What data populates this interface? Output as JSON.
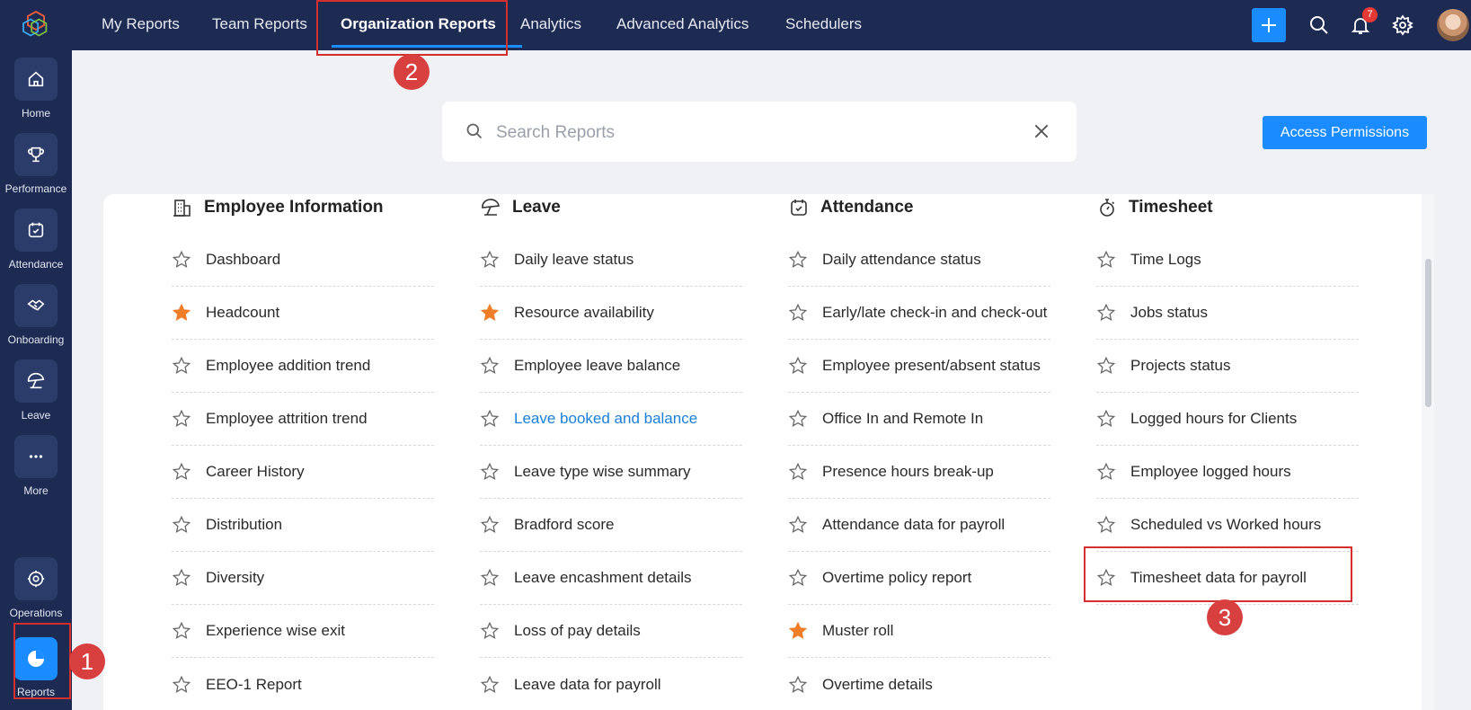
{
  "sidebar": {
    "items": [
      {
        "label": "Home",
        "icon": "home-icon"
      },
      {
        "label": "Performance",
        "icon": "trophy-icon"
      },
      {
        "label": "Attendance",
        "icon": "calendar-check-icon"
      },
      {
        "label": "Onboarding",
        "icon": "handshake-icon"
      },
      {
        "label": "Leave",
        "icon": "umbrella-icon"
      },
      {
        "label": "More",
        "icon": "more-icon"
      },
      {
        "label": "Operations",
        "icon": "operations-icon"
      },
      {
        "label": "Reports",
        "icon": "pie-chart-icon"
      }
    ]
  },
  "topnav": {
    "tabs": [
      {
        "label": "My Reports"
      },
      {
        "label": "Team Reports"
      },
      {
        "label": "Organization Reports"
      },
      {
        "label": "Analytics"
      },
      {
        "label": "Advanced Analytics"
      },
      {
        "label": "Schedulers"
      }
    ],
    "notification_count": "7"
  },
  "search": {
    "placeholder": "Search Reports"
  },
  "access_permissions_label": "Access Permissions",
  "columns": [
    {
      "title": "Employee Information",
      "icon": "building-icon",
      "items": [
        {
          "label": "Dashboard",
          "starred": false
        },
        {
          "label": "Headcount",
          "starred": true
        },
        {
          "label": "Employee addition trend",
          "starred": false
        },
        {
          "label": "Employee attrition trend",
          "starred": false
        },
        {
          "label": "Career History",
          "starred": false
        },
        {
          "label": "Distribution",
          "starred": false
        },
        {
          "label": "Diversity",
          "starred": false
        },
        {
          "label": "Experience wise exit",
          "starred": false
        },
        {
          "label": "EEO-1 Report",
          "starred": false
        }
      ]
    },
    {
      "title": "Leave",
      "icon": "umbrella-icon",
      "items": [
        {
          "label": "Daily leave status",
          "starred": false
        },
        {
          "label": "Resource availability",
          "starred": true
        },
        {
          "label": "Employee leave balance",
          "starred": false
        },
        {
          "label": "Leave booked and balance",
          "starred": false,
          "link": true
        },
        {
          "label": "Leave type wise summary",
          "starred": false
        },
        {
          "label": "Bradford score",
          "starred": false
        },
        {
          "label": "Leave encashment details",
          "starred": false
        },
        {
          "label": "Loss of pay details",
          "starred": false
        },
        {
          "label": "Leave data for payroll",
          "starred": false
        }
      ]
    },
    {
      "title": "Attendance",
      "icon": "calendar-check-icon",
      "items": [
        {
          "label": "Daily attendance status",
          "starred": false
        },
        {
          "label": "Early/late check-in and check-out",
          "starred": false
        },
        {
          "label": "Employee present/absent status",
          "starred": false
        },
        {
          "label": "Office In and Remote In",
          "starred": false
        },
        {
          "label": "Presence hours break-up",
          "starred": false
        },
        {
          "label": "Attendance data for payroll",
          "starred": false
        },
        {
          "label": "Overtime policy report",
          "starred": false
        },
        {
          "label": "Muster roll",
          "starred": true
        },
        {
          "label": "Overtime details",
          "starred": false
        }
      ]
    },
    {
      "title": "Timesheet",
      "icon": "stopwatch-icon",
      "items": [
        {
          "label": "Time Logs",
          "starred": false
        },
        {
          "label": "Jobs status",
          "starred": false
        },
        {
          "label": "Projects status",
          "starred": false
        },
        {
          "label": "Logged hours for Clients",
          "starred": false
        },
        {
          "label": "Employee logged hours",
          "starred": false
        },
        {
          "label": "Scheduled vs Worked hours",
          "starred": false
        },
        {
          "label": "Timesheet data for payroll",
          "starred": false
        }
      ]
    }
  ],
  "annotations": [
    {
      "number": "1"
    },
    {
      "number": "2"
    },
    {
      "number": "3"
    }
  ],
  "colors": {
    "nav_bg": "#1d2a52",
    "accent": "#1a8cff",
    "star_filled": "#f07d28",
    "highlight": "#d32f2f"
  }
}
